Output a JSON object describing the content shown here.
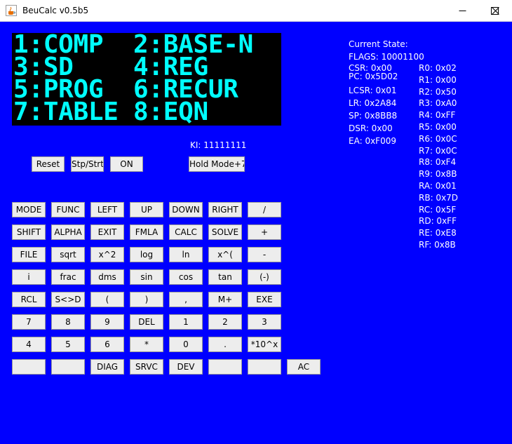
{
  "window": {
    "title": "BeuCalc v0.5b5"
  },
  "lcd": {
    "lines": [
      "1:COMP  2:BASE-N",
      "3:SD    4:REG",
      "5:PROG  6:RECUR",
      "7:TABLE 8:EQN"
    ]
  },
  "ki": "KI: 11111111",
  "controls": {
    "reset": "Reset",
    "stp_strt": "Stp/Strt",
    "on": "ON",
    "hold_mode": "Hold Mode+7"
  },
  "state": {
    "heading": "Current State:",
    "flags": "FLAGS: 10001100",
    "csr": "CSR: 0x00",
    "pc": "PC: 0x5D02",
    "lcsr": "LCSR: 0x01",
    "lr": "LR: 0x2A84",
    "sp": "SP: 0x8BB8",
    "dsr": "DSR: 0x00",
    "ea": "EA: 0xF009",
    "registers": [
      "R0: 0x02",
      "R1: 0x00",
      "R2: 0x50",
      "R3: 0xA0",
      "R4: 0xFF",
      "R5: 0x00",
      "R6: 0x0C",
      "R7: 0x0C",
      "R8: 0xF4",
      "R9: 0x8B",
      "RA: 0x01",
      "RB: 0x7D",
      "RC: 0x5F",
      "RD: 0xFF",
      "RE: 0xE8",
      "RF: 0x8B"
    ]
  },
  "keypad": {
    "rows": [
      [
        "MODE",
        "FUNC",
        "LEFT",
        "UP",
        "DOWN",
        "RIGHT",
        "/"
      ],
      [
        "SHIFT",
        "ALPHA",
        "EXIT",
        "FMLA",
        "CALC",
        "SOLVE",
        "+"
      ],
      [
        "FILE",
        "sqrt",
        "x^2",
        "log",
        "ln",
        "x^(",
        "-"
      ],
      [
        "i",
        "frac",
        "dms",
        "sin",
        "cos",
        "tan",
        "(-)"
      ],
      [
        "RCL",
        "S<>D",
        "(",
        ")",
        ",",
        "M+",
        "EXE"
      ],
      [
        "7",
        "8",
        "9",
        "DEL",
        "1",
        "2",
        "3"
      ],
      [
        "4",
        "5",
        "6",
        "*",
        "0",
        ".",
        "*10^x"
      ],
      [
        "",
        "",
        "DIAG",
        "SRVC",
        "DEV",
        "",
        "",
        "AC"
      ]
    ]
  }
}
